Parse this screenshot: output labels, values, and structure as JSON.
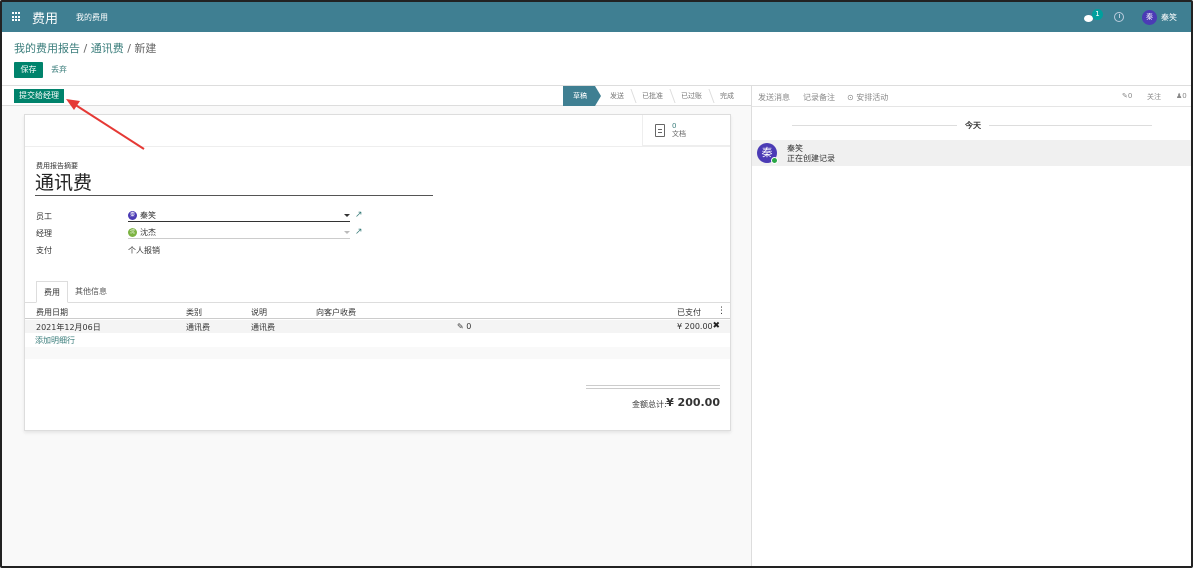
{
  "topbar": {
    "app_title": "费用",
    "menu_my_expenses": "我的费用",
    "chat_badge": "1",
    "user_avatar_text": "秦",
    "user_name": "秦笑"
  },
  "breadcrumb": {
    "part1": "我的费用报告",
    "part2": "通讯费",
    "current": "新建"
  },
  "buttons": {
    "save": "保存",
    "discard": "丢弃",
    "submit": "提交给经理"
  },
  "statusbar": {
    "stages": [
      "草稿",
      "发送",
      "已批准",
      "已过账",
      "完成"
    ],
    "active_stage": "草稿"
  },
  "smart_button": {
    "count": "0",
    "label": "文档"
  },
  "form": {
    "summary_label": "费用报告摘要",
    "summary_value": "通讯费",
    "employee_label": "员工",
    "employee_avatar_text": "秦",
    "employee_value": "秦笑",
    "manager_label": "经理",
    "manager_avatar_text": "沈",
    "manager_value": "沈杰",
    "payment_label": "支付",
    "payment_value": "个人报销"
  },
  "tabs": [
    "费用",
    "其他信息"
  ],
  "table": {
    "headers": [
      "费用日期",
      "类别",
      "说明",
      "向客户收费",
      "已支付"
    ],
    "rows": [
      {
        "date": "2021年12月06日",
        "category": "通讯费",
        "description": "通讯费",
        "attachments": "0",
        "amount": "¥ 200.00"
      }
    ],
    "add_line": "添加明细行"
  },
  "totals": {
    "label": "金额总计:",
    "value": "¥ 200.00"
  },
  "chatter": {
    "send_message": "发送消息",
    "log_note": "记录备注",
    "schedule_activity": "安排活动",
    "attachment_count": "0",
    "follow": "关注",
    "follower_count": "0",
    "date_separator": "今天",
    "message_author": "秦笑",
    "message_avatar_text": "秦",
    "message_body": "正在创建记录"
  },
  "colors": {
    "navbar": "#3f7f92",
    "primary_button": "#00836c",
    "link": "#3a7d7b",
    "annotation_arrow": "#e53935"
  }
}
